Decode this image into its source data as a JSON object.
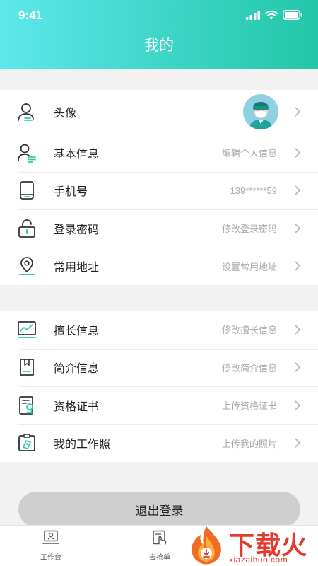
{
  "status_bar": {
    "time": "9:41"
  },
  "header": {
    "title": "我的"
  },
  "profile_section": [
    {
      "label": "头像",
      "value": "",
      "icon": "user-icon"
    },
    {
      "label": "基本信息",
      "value": "编辑个人信息",
      "icon": "user-info-icon"
    },
    {
      "label": "手机号",
      "value": "139******59",
      "icon": "phone-icon"
    },
    {
      "label": "登录密码",
      "value": "修改登录密码",
      "icon": "lock-icon"
    },
    {
      "label": "常用地址",
      "value": "设置常用地址",
      "icon": "location-icon"
    }
  ],
  "professional_section": [
    {
      "label": "擅长信息",
      "value": "修改擅长信息",
      "icon": "chart-icon"
    },
    {
      "label": "简介信息",
      "value": "修改简介信息",
      "icon": "book-icon"
    },
    {
      "label": "资格证书",
      "value": "上传资格证书",
      "icon": "certificate-icon"
    },
    {
      "label": "我的工作照",
      "value": "上传我的照片",
      "icon": "photo-icon"
    }
  ],
  "logout_button": "退出登录",
  "tabbar": [
    {
      "label": "工作台",
      "icon": "workbench-icon"
    },
    {
      "label": "去抢单",
      "icon": "grab-order-icon"
    }
  ],
  "watermark": {
    "text": "下载火",
    "url_text": "xiazaihuo.com"
  },
  "colors": {
    "accent": "#3fd6c9",
    "accent_dark": "#23c6a8",
    "watermark": "#e23a2c"
  }
}
